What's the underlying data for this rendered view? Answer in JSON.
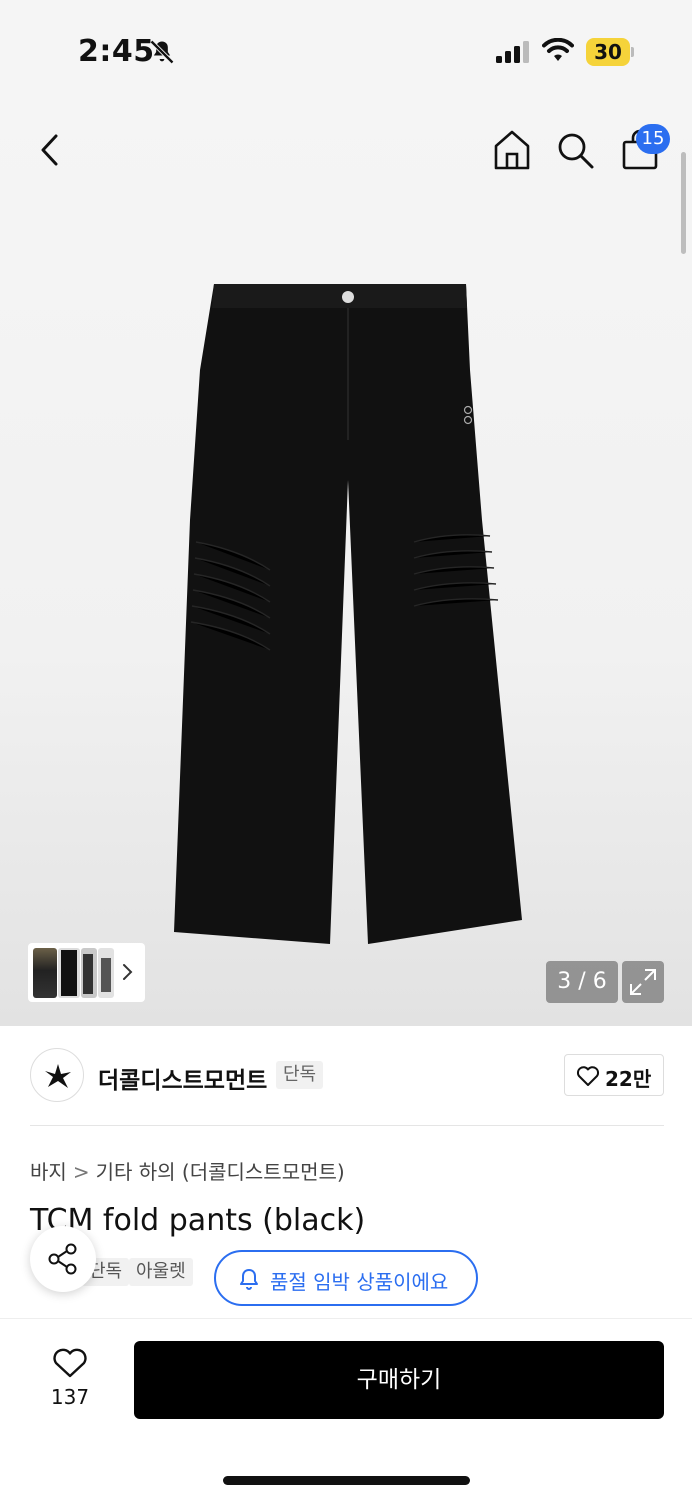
{
  "status_bar": {
    "time": "2:45",
    "battery": "30",
    "icons": [
      "bell-slash-icon",
      "signal-icon",
      "wifi-icon",
      "battery-icon"
    ]
  },
  "header": {
    "cart_badge": "15",
    "icons": [
      "back-chevron-icon",
      "home-icon",
      "search-icon",
      "shopping-bag-icon"
    ]
  },
  "gallery": {
    "counter": "3 / 6",
    "icons": [
      "expand-icon",
      "chevron-right-icon"
    ]
  },
  "brand": {
    "name": "더콜디스트모먼트",
    "badge": "단독",
    "likes": "22만"
  },
  "breadcrumb": {
    "level1": "바지",
    "separator": ">",
    "level2": "기타 하의 (더콜디스트모먼트)"
  },
  "product": {
    "title": "TCM fold pants (black)",
    "tags": [
      "단독",
      "아울렛"
    ],
    "restock_alert": "품절 임박 상품이에요"
  },
  "bottom_bar": {
    "wishlist_count": "137",
    "buy_label": "구매하기"
  },
  "colors": {
    "accent_blue": "#2b6ef0",
    "buy_button": "#000000",
    "battery": "#f5d33a"
  }
}
